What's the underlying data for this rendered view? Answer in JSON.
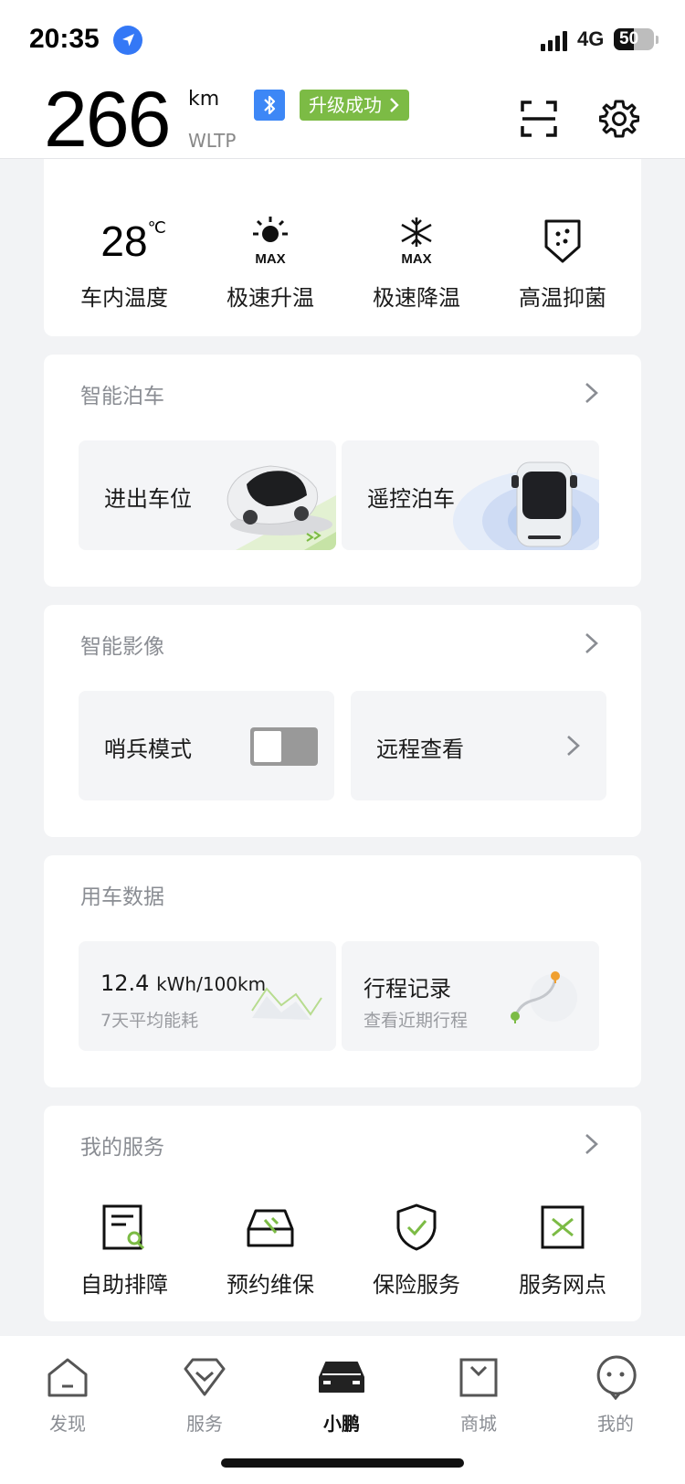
{
  "status_bar": {
    "time": "20:35",
    "network": "4G",
    "battery": "50",
    "battery_level": 0.5
  },
  "header": {
    "range_value": "266",
    "range_unit": "km",
    "range_standard": "WLTP",
    "update_badge": "升级成功",
    "icons": [
      "bluetooth-icon",
      "scan-icon",
      "gear-icon"
    ]
  },
  "climate": {
    "temp_value": "28",
    "temp_unit": "℃",
    "items": [
      {
        "label": "车内温度"
      },
      {
        "label": "极速升温",
        "icon_text": "MAX"
      },
      {
        "label": "极速降温",
        "icon_text": "MAX"
      },
      {
        "label": "高温抑菌"
      }
    ]
  },
  "parking": {
    "title": "智能泊车",
    "tiles": [
      {
        "label": "进出车位"
      },
      {
        "label": "遥控泊车"
      }
    ]
  },
  "imaging": {
    "title": "智能影像",
    "tiles": [
      {
        "label": "哨兵模式",
        "toggle_on": false
      },
      {
        "label": "远程查看"
      }
    ]
  },
  "usage": {
    "title": "用车数据",
    "energy_value": "12.4",
    "energy_unit": "kWh/100km",
    "energy_caption": "7天平均能耗",
    "trip_title": "行程记录",
    "trip_caption": "查看近期行程"
  },
  "services": {
    "title": "我的服务",
    "items": [
      {
        "label": "自助排障"
      },
      {
        "label": "预约维保"
      },
      {
        "label": "保险服务"
      },
      {
        "label": "服务网点"
      }
    ]
  },
  "tabbar": {
    "tabs": [
      {
        "label": "发现"
      },
      {
        "label": "服务"
      },
      {
        "label": "小鹏"
      },
      {
        "label": "商城"
      },
      {
        "label": "我的"
      }
    ],
    "active": "小鹏"
  },
  "colors": {
    "accent_green": "#7cbb45",
    "bluetooth_blue": "#3d87f6",
    "page_bg": "#f2f3f5"
  }
}
